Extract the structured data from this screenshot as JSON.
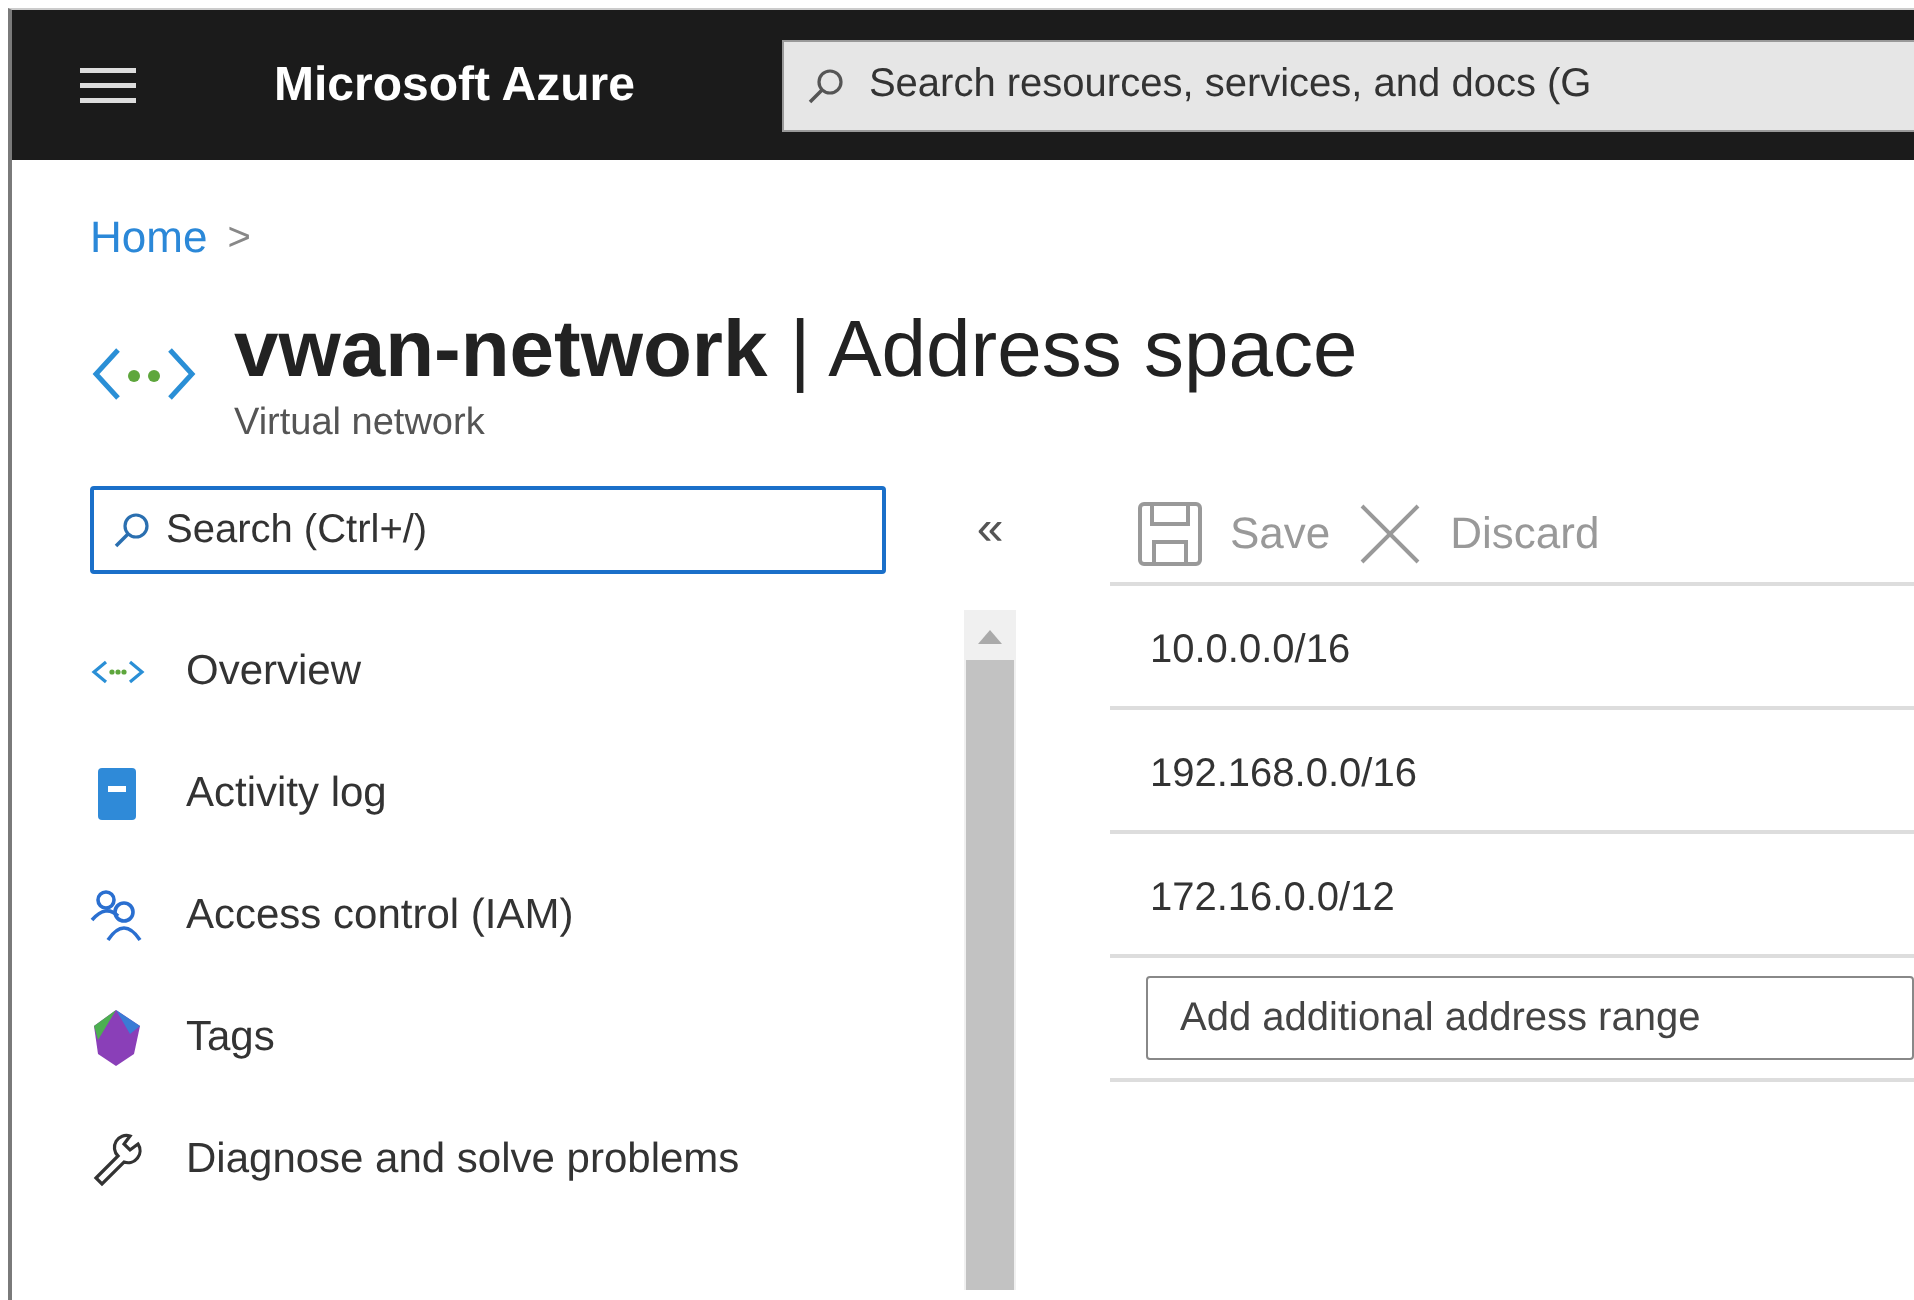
{
  "topbar": {
    "brand": "Microsoft Azure",
    "search": {
      "placeholder": "Search resources, services, and docs (G"
    }
  },
  "breadcrumb": [
    {
      "label": "Home",
      "separator": ">"
    }
  ],
  "header": {
    "title": "**vwan-network** | Address space",
    "subtitle": "Virtual network"
  },
  "sidebar": {
    "search": {
      "value": "Search (Ctrl+/)"
    },
    "collapse": "«",
    "items": [
      {
        "label": "Overview",
        "selected": false
      },
      {
        "label": "Activity log",
        "selected": false
      },
      {
        "label": "Access control (IAM)",
        "selected": false
      },
      {
        "label": "Tags",
        "selected": false
      },
      {
        "label": "Diagnose and solve problems",
        "selected": false
      }
    ]
  },
  "toolbar": [
    {
      "kind": "save",
      "label": "Save",
      "disabled": true
    },
    {
      "kind": "discard",
      "label": "Discard",
      "disabled": true
    }
  ],
  "address_ranges": [
    "10.0.0.0/16",
    "192.168.0.0/16",
    "172.16.0.0/12"
  ],
  "add_range": {
    "placeholder": "Add additional address range"
  }
}
